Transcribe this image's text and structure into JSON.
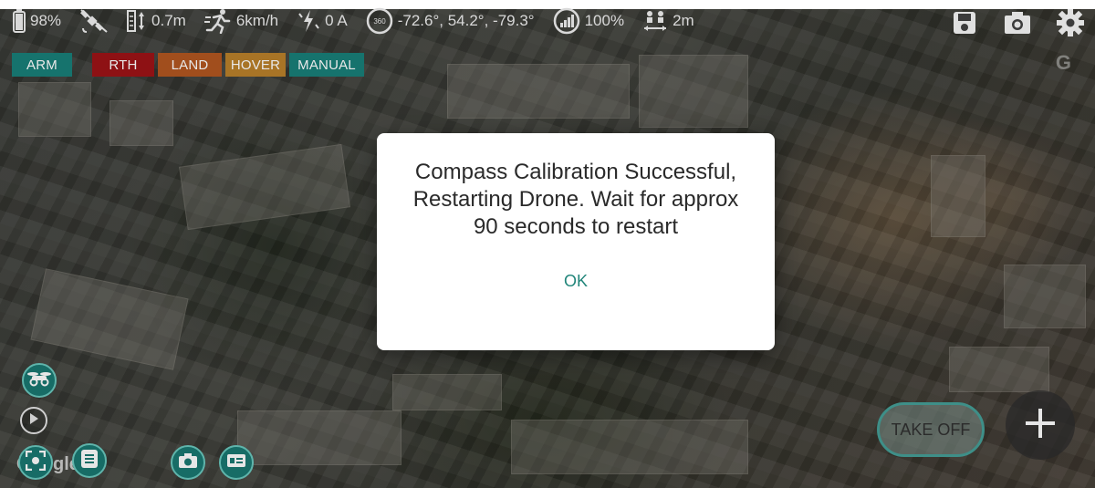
{
  "status": {
    "battery": "98%",
    "altitude": "0.7m",
    "speed": "6km/h",
    "current": "0 A",
    "orientation": "-72.6°, 54.2°, -79.3°",
    "signal": "100%",
    "distance": "2m",
    "compass_badge": "360"
  },
  "modes": {
    "arm": "ARM",
    "rth": "RTH",
    "land": "LAND",
    "hover": "HOVER",
    "manual": "MANUAL"
  },
  "colors": {
    "arm": "#16736d",
    "rth": "#8e1114",
    "land": "#a14e1d",
    "hover": "#a87426",
    "manual": "#16736d",
    "accent": "#21857a"
  },
  "dialog": {
    "message": "Compass Calibration Successful, Restarting Drone. Wait for approx 90 seconds to restart",
    "ok": "OK"
  },
  "map": {
    "watermark_letter": "G",
    "google_text": "Google"
  },
  "controls": {
    "take_off": "TAKE OFF"
  },
  "icons": [
    "battery-icon",
    "satellite-icon",
    "altitude-icon",
    "runner-icon",
    "lightning-icon",
    "compass-360-icon",
    "signal-icon",
    "distance-icon",
    "save-icon",
    "camera-icon",
    "settings-icon",
    "drone-icon",
    "play-icon",
    "focus-icon",
    "list-icon",
    "photo-icon",
    "id-card-icon",
    "plus-icon"
  ]
}
